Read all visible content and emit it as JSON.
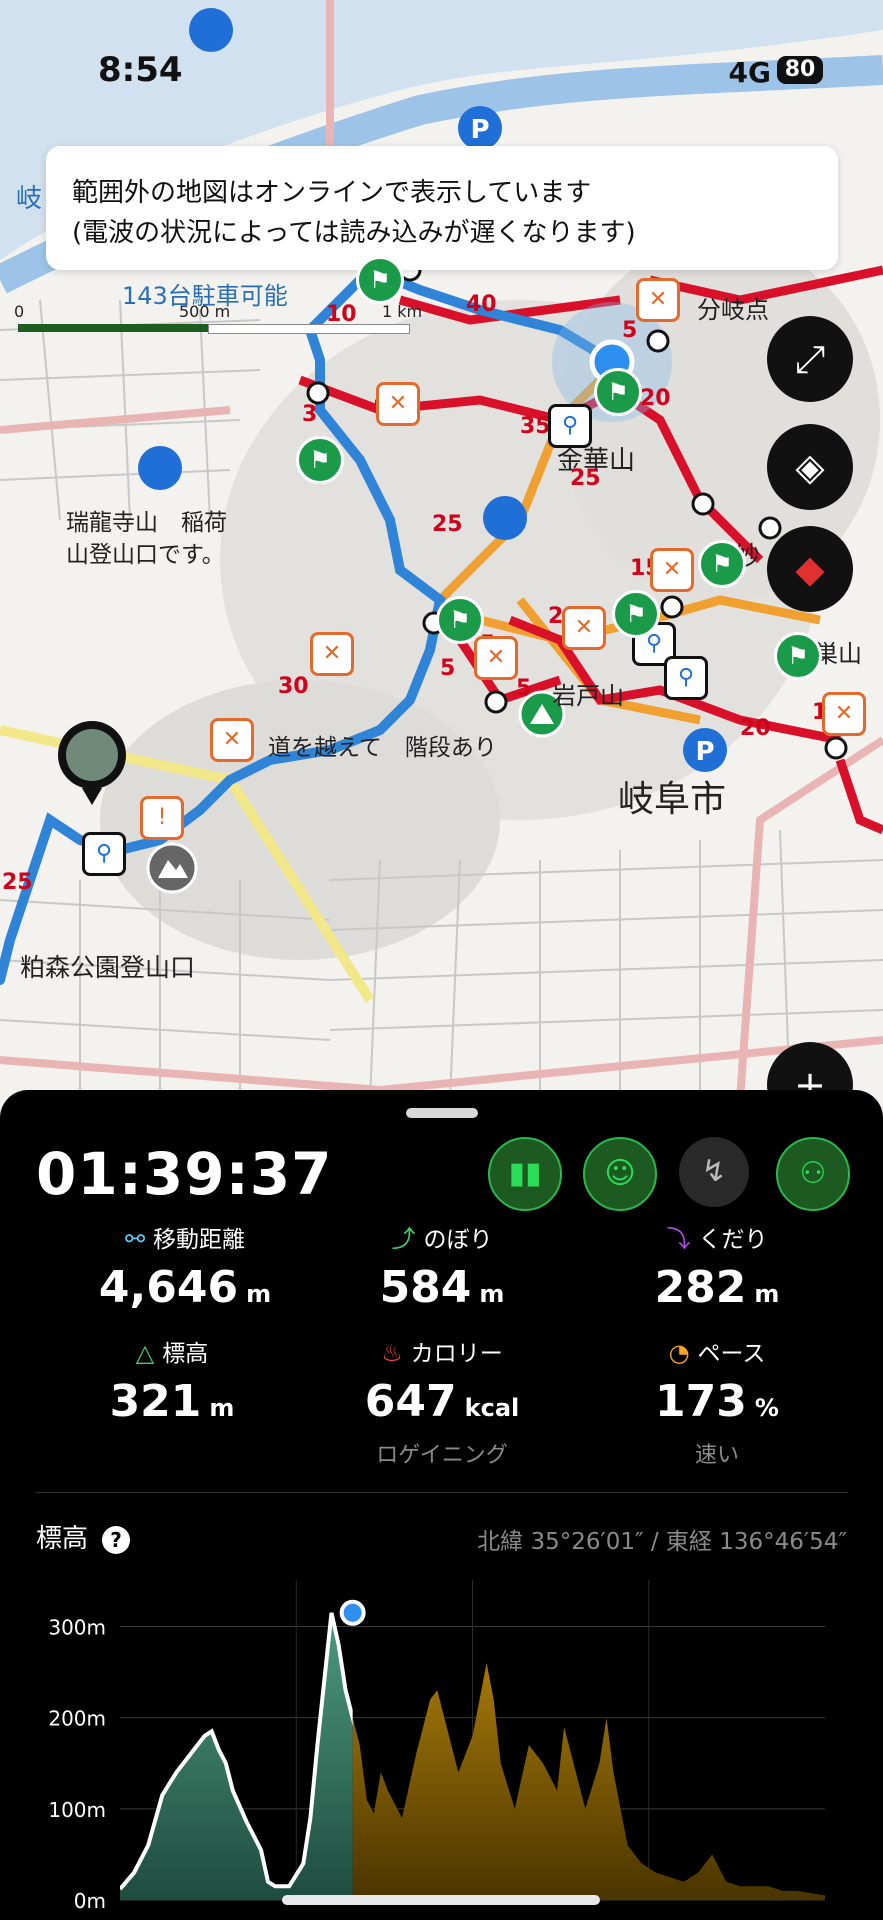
{
  "status_bar": {
    "time": "8:54",
    "network": "4G",
    "battery": "80"
  },
  "banner": {
    "line1": "範囲外の地図はオンラインで表示しています",
    "line2": "(電波の状況によっては読み込みが遅くなります)"
  },
  "map": {
    "scale": {
      "zero": "0",
      "mid": "500 m",
      "end": "1 km"
    },
    "labels": {
      "parking": "143台駐車可能",
      "branch": "分岐点",
      "kinka": "金華山",
      "zuiryu_1": "瑞龍寺山　稲荷",
      "zuiryu_2": "山登山口です。",
      "iwato": "岩戸山",
      "road": "道を越えて　階段あり",
      "gifu_city": "岐阜市",
      "kashimori": "粕森公園登山口",
      "takasu": "鷹巣山",
      "myo": "妙",
      "gi": "岐"
    },
    "route_numbers": [
      "10",
      "40",
      "5",
      "20",
      "45",
      "3",
      "35",
      "25",
      "25",
      "15",
      "20",
      "5",
      "5",
      "5",
      "30",
      "10",
      "20",
      "15",
      "25"
    ],
    "buttons": {
      "expand": "expand-icon",
      "layers": "layers-icon",
      "compass": "compass-icon",
      "zoom_in": "+"
    }
  },
  "activity": {
    "elapsed": "01:39:37",
    "stats": [
      {
        "label": "移動距離",
        "value": "4,646",
        "unit": "m",
        "icon": "distance-icon",
        "icon_color": "#5ec8f2"
      },
      {
        "label": "のぼり",
        "value": "584",
        "unit": "m",
        "icon": "ascent-icon",
        "icon_color": "#3fd16e"
      },
      {
        "label": "くだり",
        "value": "282",
        "unit": "m",
        "icon": "descent-icon",
        "icon_color": "#b04fe8"
      },
      {
        "label": "標高",
        "value": "321",
        "unit": "m",
        "icon": "mountain-icon",
        "icon_color": "#3fd16e"
      },
      {
        "label": "カロリー",
        "value": "647",
        "unit": "kcal",
        "icon": "flame-icon",
        "icon_color": "#ff4d3a",
        "sub": "ロゲイニング"
      },
      {
        "label": "ペース",
        "value": "173",
        "unit": "%",
        "icon": "speedometer-icon",
        "icon_color": "#f5a623",
        "sub": "速い"
      }
    ]
  },
  "elevation": {
    "title": "標高",
    "coords": "北緯 35°26′01″ / 東経 136°46′54″"
  },
  "chart_data": {
    "type": "area",
    "title": "標高",
    "xlabel": "",
    "ylabel": "",
    "y_ticks": [
      "300m",
      "200m",
      "100m",
      "0m"
    ],
    "ylim": [
      0,
      340
    ],
    "grid": true,
    "current_point": {
      "x": 0.33,
      "y": 315
    },
    "series": [
      {
        "x": [
          0,
          0.02,
          0.04,
          0.06,
          0.08,
          0.1,
          0.12,
          0.13,
          0.14,
          0.15,
          0.16,
          0.18,
          0.2,
          0.21,
          0.22,
          0.24,
          0.26,
          0.27,
          0.28,
          0.3,
          0.31,
          0.32,
          0.33,
          0.34,
          0.35,
          0.36,
          0.37,
          0.38,
          0.4,
          0.42,
          0.44,
          0.45,
          0.46,
          0.48,
          0.5,
          0.52,
          0.53,
          0.54,
          0.56,
          0.58,
          0.6,
          0.62,
          0.63,
          0.64,
          0.66,
          0.68,
          0.69,
          0.7,
          0.72,
          0.74,
          0.76,
          0.78,
          0.8,
          0.82,
          0.84,
          0.86,
          0.88,
          0.9,
          0.92,
          0.94,
          0.96,
          1.0
        ],
        "values": [
          12,
          30,
          60,
          115,
          140,
          160,
          180,
          185,
          165,
          150,
          120,
          85,
          55,
          20,
          15,
          15,
          40,
          90,
          170,
          315,
          280,
          230,
          200,
          170,
          110,
          95,
          140,
          120,
          90,
          160,
          220,
          230,
          200,
          140,
          180,
          260,
          220,
          150,
          100,
          170,
          150,
          120,
          190,
          160,
          100,
          150,
          200,
          140,
          60,
          40,
          30,
          25,
          20,
          30,
          50,
          20,
          15,
          15,
          15,
          10,
          10,
          5
        ]
      }
    ]
  }
}
